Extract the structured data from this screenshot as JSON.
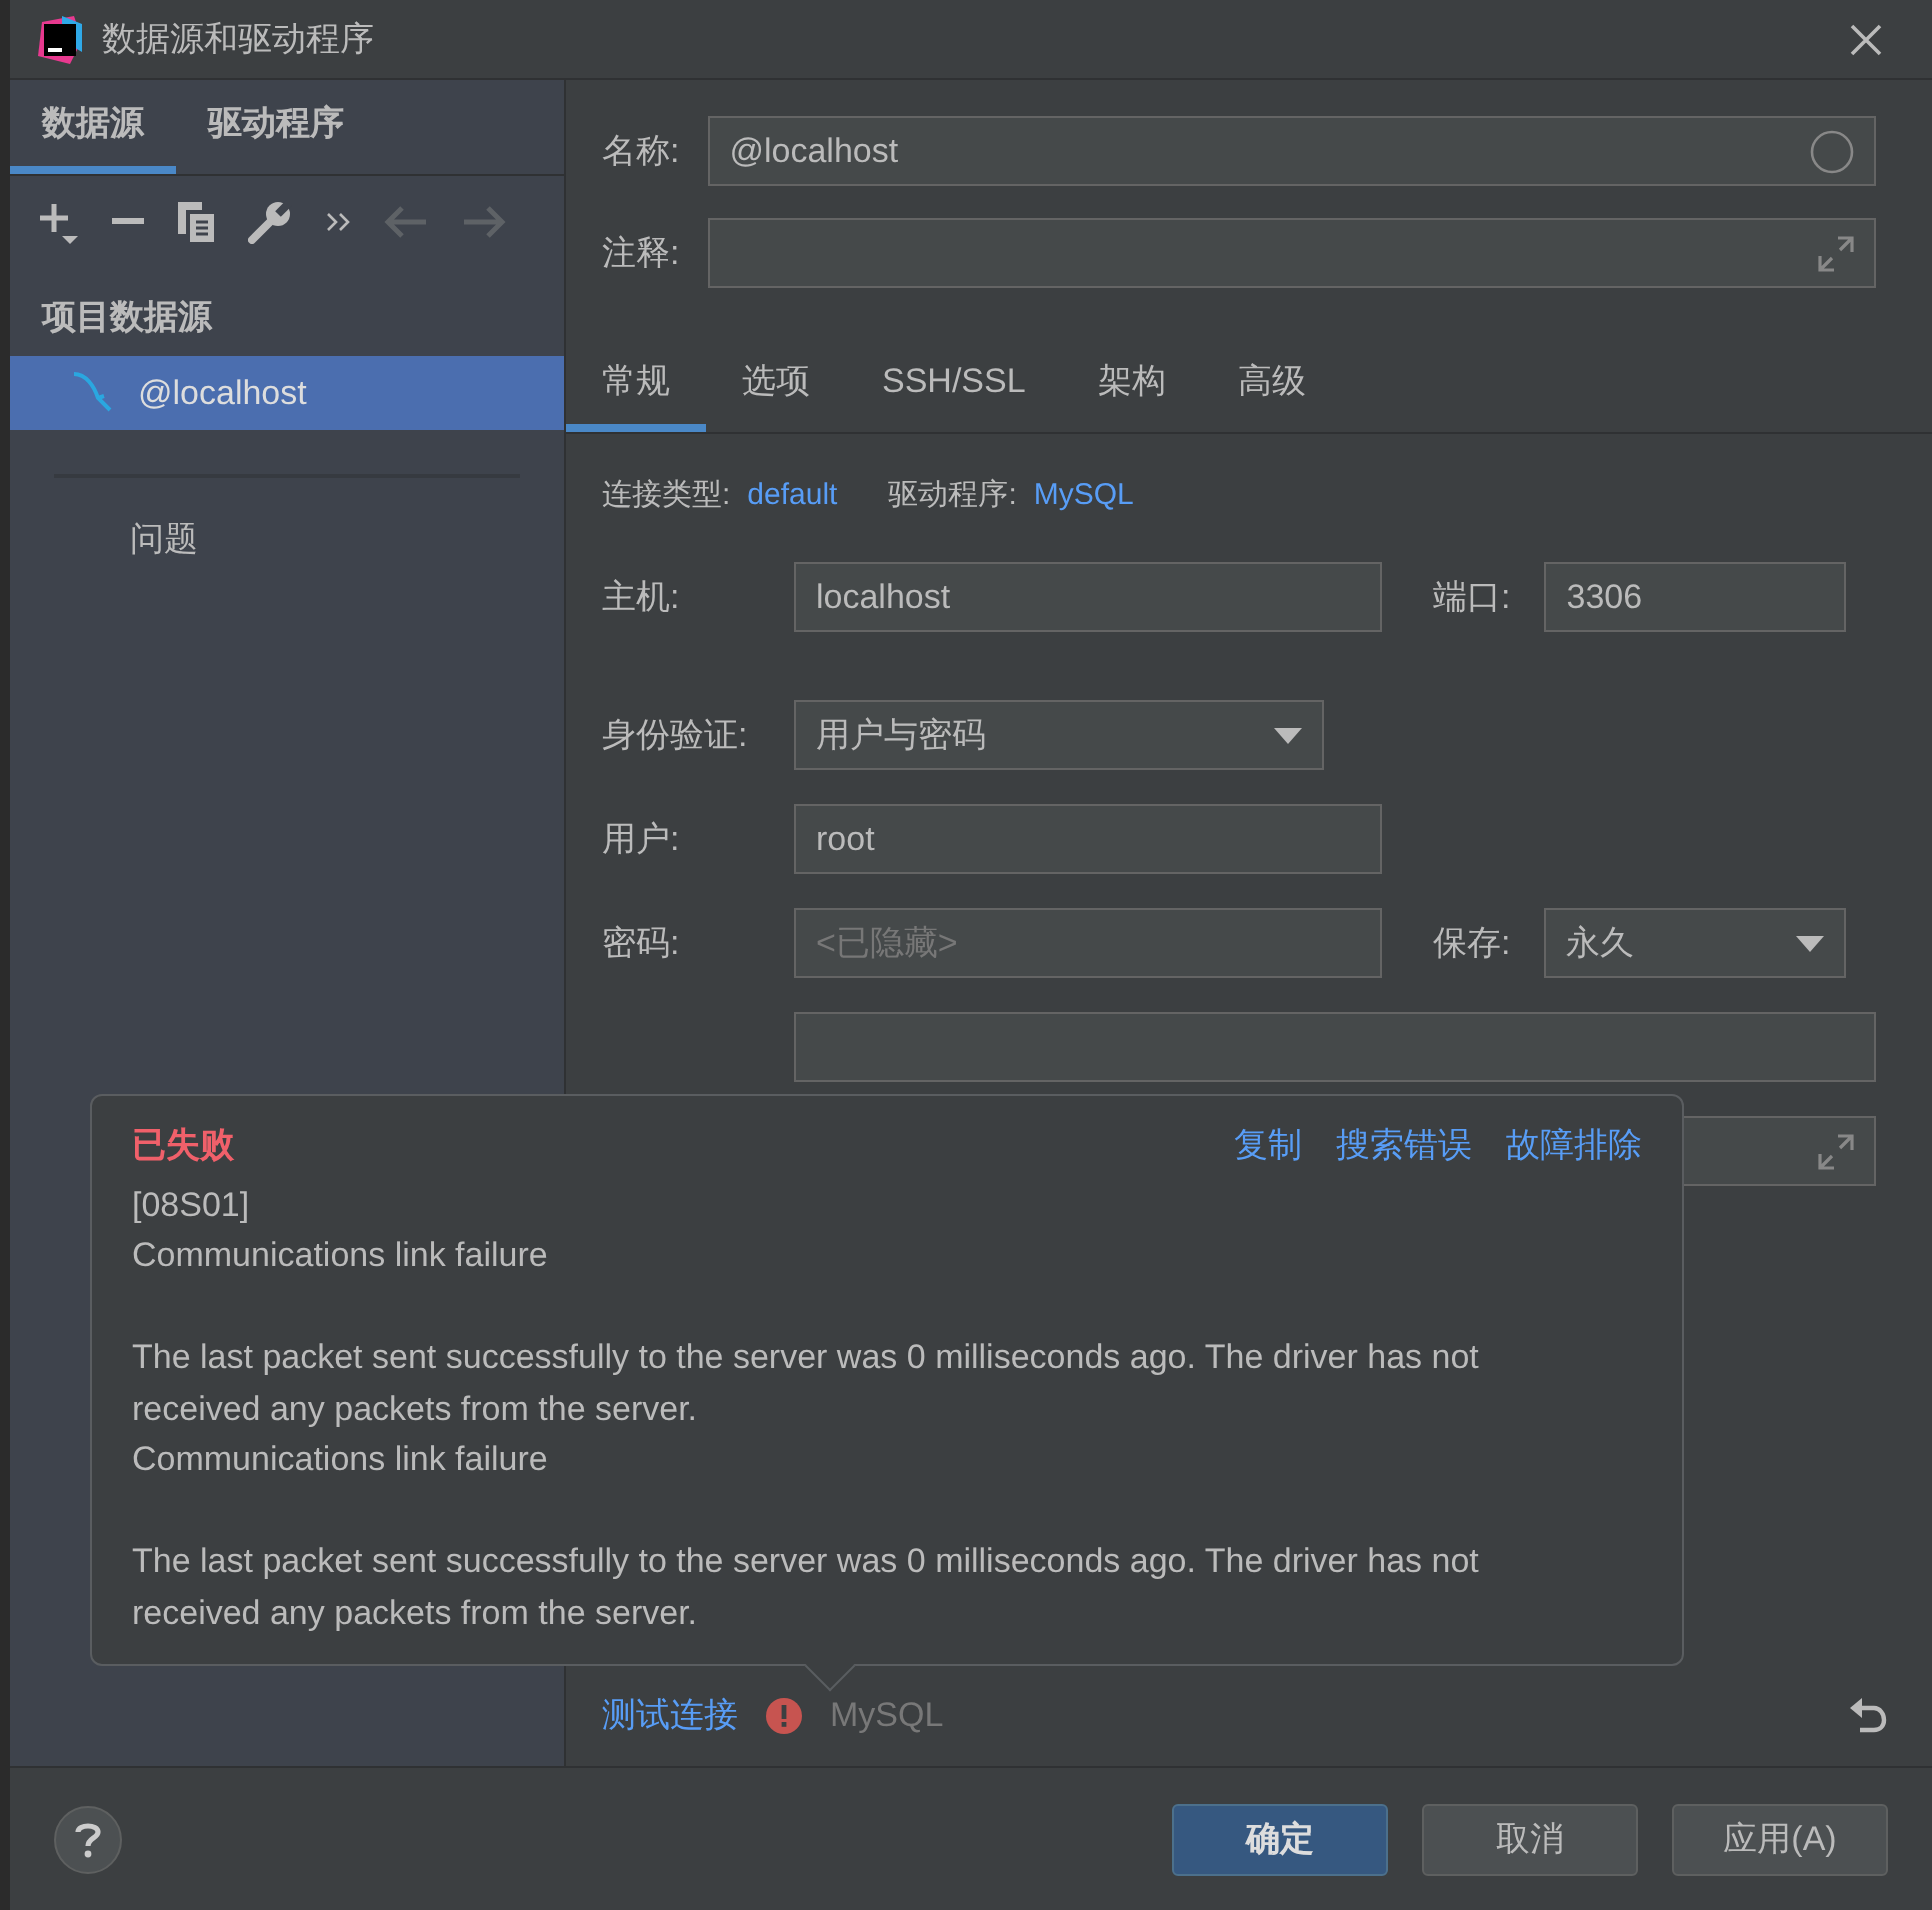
{
  "window": {
    "title": "数据源和驱动程序"
  },
  "sidebar": {
    "tabs": [
      {
        "label": "数据源",
        "selected": true
      },
      {
        "label": "驱动程序",
        "selected": false
      }
    ],
    "section": "项目数据源",
    "items": [
      {
        "label": "@localhost",
        "selected": true
      }
    ],
    "problems": "问题"
  },
  "form": {
    "name": {
      "label": "名称:",
      "value": "@localhost"
    },
    "comment": {
      "label": "注释:"
    },
    "tabs": [
      {
        "label": "常规",
        "selected": true
      },
      {
        "label": "选项",
        "selected": false
      },
      {
        "label": "SSH/SSL",
        "selected": false
      },
      {
        "label": "架构",
        "selected": false
      },
      {
        "label": "高级",
        "selected": false
      }
    ],
    "connection_type": {
      "label": "连接类型:",
      "value": "default"
    },
    "driver": {
      "label": "驱动程序:",
      "value": "MySQL"
    },
    "host": {
      "label": "主机:",
      "value": "localhost"
    },
    "port": {
      "label": "端口:",
      "value": "3306"
    },
    "auth": {
      "label": "身份验证:",
      "value": "用户与密码"
    },
    "user": {
      "label": "用户:",
      "value": "root"
    },
    "password": {
      "label": "密码:",
      "placeholder": "<已隐藏>"
    },
    "save": {
      "label": "保存:",
      "value": "永久"
    }
  },
  "error_popup": {
    "title": "已失败",
    "actions": [
      "复制",
      "搜索错误",
      "故障排除"
    ],
    "paragraphs": [
      [
        "[08S01]",
        "Communications link failure"
      ],
      [
        "The last packet sent successfully to the server was 0 milliseconds ago. The driver has not received any packets from the server.",
        "Communications link failure"
      ],
      [
        "The last packet sent successfully to the server was 0 milliseconds ago. The driver has not received any packets from the server."
      ]
    ]
  },
  "test_bar": {
    "link": "测试连接",
    "status": "MySQL"
  },
  "buttons": [
    {
      "label": "确定",
      "kind": "primary"
    },
    {
      "label": "取消",
      "kind": "normal"
    },
    {
      "label": "应用(A)",
      "kind": "normal"
    }
  ]
}
